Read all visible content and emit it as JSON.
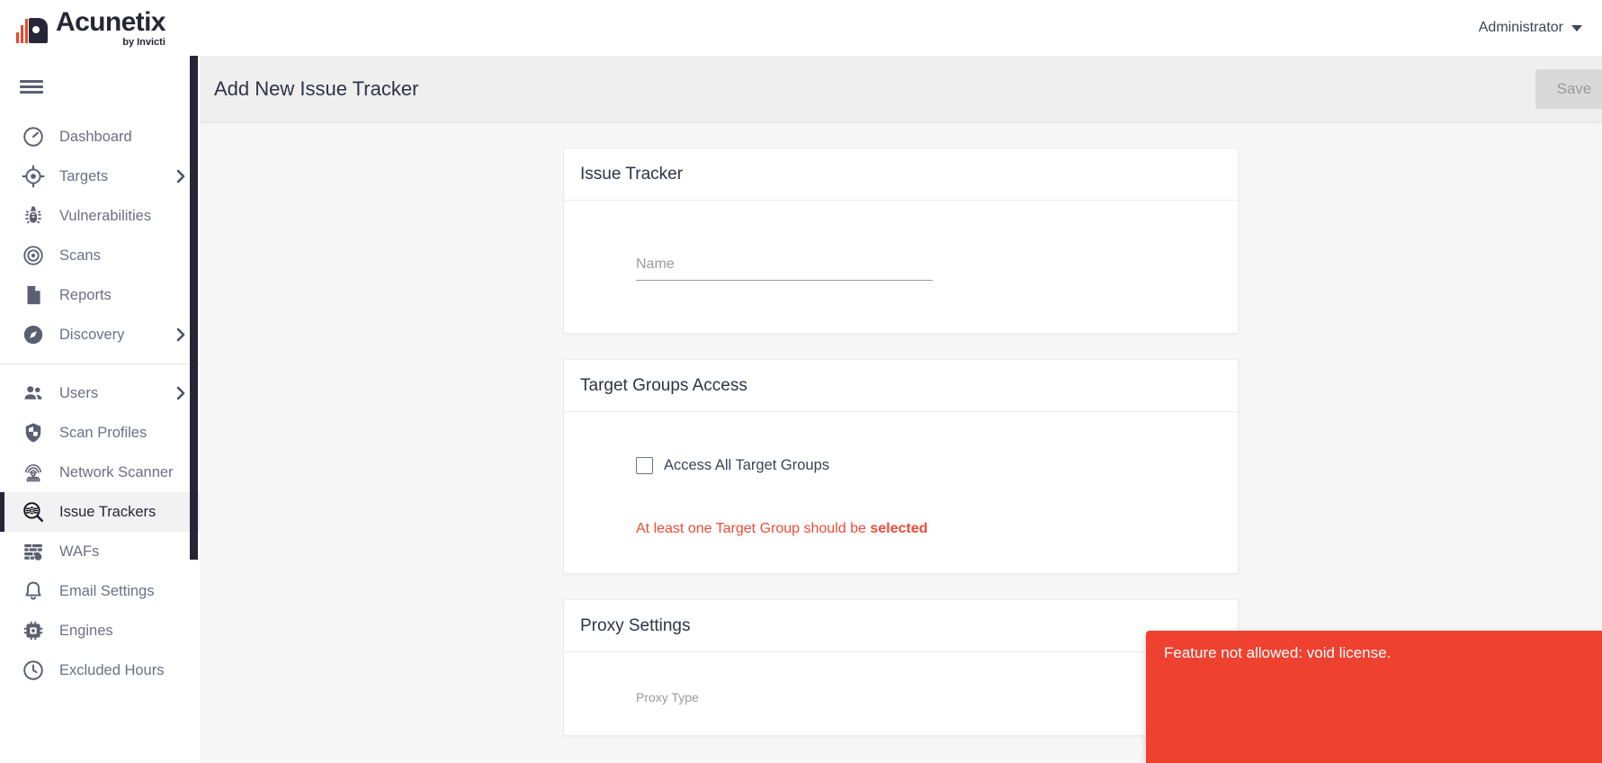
{
  "app": {
    "brand_word": "Acunetix",
    "brand_sub": "by Invicti",
    "brand_mark_icon": "acunetix-logo-icon"
  },
  "topbar": {
    "account_label": "Administrator",
    "account_caret_icon": "caret-down-icon",
    "menu_toggle_icon": "hamburger-icon"
  },
  "sidebar": {
    "groups": [
      {
        "items": [
          {
            "label": "Dashboard",
            "icon": "speedometer-icon",
            "chevron": false,
            "active": false
          },
          {
            "label": "Targets",
            "icon": "crosshair-icon",
            "chevron": true,
            "active": false
          },
          {
            "label": "Vulnerabilities",
            "icon": "bug-icon",
            "chevron": false,
            "active": false
          },
          {
            "label": "Scans",
            "icon": "radar-icon",
            "chevron": false,
            "active": false
          },
          {
            "label": "Reports",
            "icon": "document-icon",
            "chevron": false,
            "active": false
          },
          {
            "label": "Discovery",
            "icon": "compass-icon",
            "chevron": true,
            "active": false
          }
        ]
      },
      {
        "items": [
          {
            "label": "Users",
            "icon": "users-icon",
            "chevron": true,
            "active": false
          },
          {
            "label": "Scan Profiles",
            "icon": "shield-icon",
            "chevron": false,
            "active": false
          },
          {
            "label": "Network Scanner",
            "icon": "network-scanner-icon",
            "chevron": false,
            "active": false
          },
          {
            "label": "Issue Trackers",
            "icon": "bug-search-icon",
            "chevron": false,
            "active": true
          },
          {
            "label": "WAFs",
            "icon": "firewall-icon",
            "chevron": false,
            "active": false
          },
          {
            "label": "Email Settings",
            "icon": "bell-icon",
            "chevron": false,
            "active": false
          },
          {
            "label": "Engines",
            "icon": "chip-icon",
            "chevron": false,
            "active": false
          },
          {
            "label": "Excluded Hours",
            "icon": "clock-icon",
            "chevron": false,
            "active": false
          }
        ]
      }
    ]
  },
  "page": {
    "title": "Add New Issue Tracker",
    "save_label": "Save"
  },
  "cards": {
    "issue_tracker": {
      "title": "Issue Tracker",
      "name_placeholder": "Name",
      "name_value": ""
    },
    "target_groups_access": {
      "title": "Target Groups Access",
      "checkbox_label": "Access All Target Groups",
      "checkbox_checked": false,
      "error_prefix": "At least one Target Group should be ",
      "error_emphasis": "selected",
      "error_color": "#ef4b36"
    },
    "proxy_settings": {
      "title": "Proxy Settings",
      "proxy_type_label": "Proxy Type"
    }
  },
  "toast": {
    "message": "Feature not allowed: void license.",
    "background": "#ef4130",
    "text_color": "#ffffff"
  }
}
